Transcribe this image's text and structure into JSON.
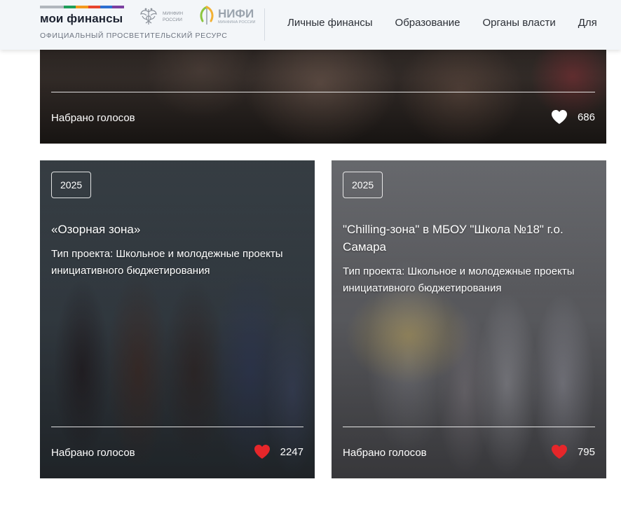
{
  "header": {
    "logo_title": "мои финансы",
    "logo_subtitle": "ОФИЦИАЛЬНЫЙ ПРОСВЕТИТЕЛЬСКИЙ РЕСУРС",
    "logo_stripe_colors": [
      "#b0b6bd",
      "#1f9e5a",
      "#f39a1e",
      "#e8452d",
      "#2c6fd1",
      "#7b3fa0"
    ],
    "minfin_line1": "МИНФИН",
    "minfin_line2": "РОССИИ",
    "nifi_name": "НИФИ",
    "nifi_sub": "МИНФИНА РОССИИ",
    "nav": [
      {
        "label": "Личные финансы"
      },
      {
        "label": "Образование"
      },
      {
        "label": "Органы власти"
      },
      {
        "label": "Для"
      }
    ]
  },
  "cards": {
    "top": {
      "votes_label": "Набрано голосов",
      "votes": "686",
      "heart_color": "#ffffff"
    },
    "left": {
      "year": "2025",
      "title": "«Озорная зона»",
      "type": "Тип проекта: Школьное и молодежные проекты инициативного бюджетирования",
      "votes_label": "Набрано голосов",
      "votes": "2247",
      "heart_color": "#e6262a"
    },
    "right": {
      "year": "2025",
      "title": "\"Chilling-зона\" в МБОУ \"Школа №18\" г.о. Самара",
      "type": "Тип проекта: Школьное и молодежные проекты инициативного бюджетирования",
      "votes_label": "Набрано голосов",
      "votes": "795",
      "heart_color": "#e6262a"
    }
  }
}
